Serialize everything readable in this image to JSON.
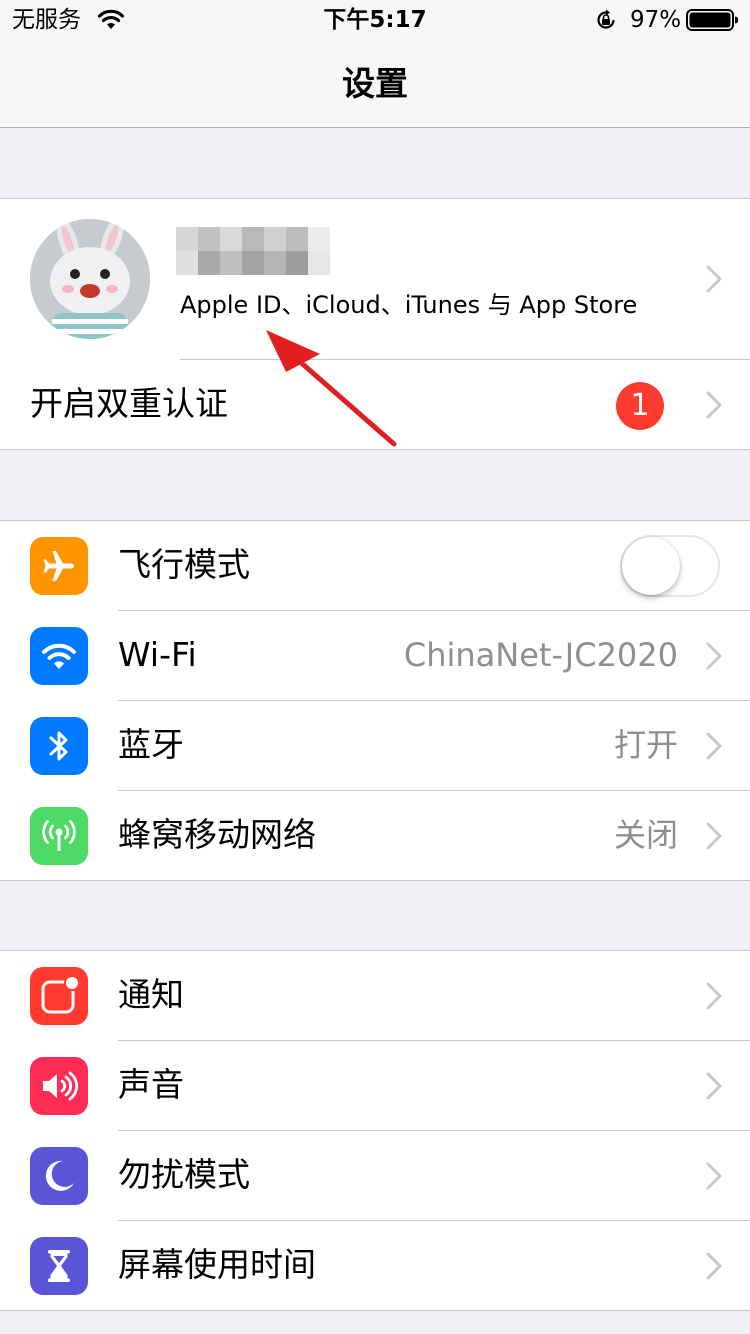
{
  "status_bar": {
    "carrier": "无服务",
    "time": "下午5:17",
    "battery_percent": "97%",
    "icons": [
      "wifi-icon",
      "orientation-lock-icon",
      "battery-icon"
    ]
  },
  "nav": {
    "title": "设置"
  },
  "apple_id": {
    "subtitle": "Apple ID、iCloud、iTunes 与 App Store",
    "name_blurred": true
  },
  "two_factor": {
    "label": "开启双重认证",
    "badge": "1"
  },
  "connectivity": [
    {
      "label": "飞行模式",
      "icon": "airplane-icon",
      "icon_color": "#ff9500",
      "control": "toggle",
      "toggle_on": false
    },
    {
      "label": "Wi-Fi",
      "value": "ChinaNet-JC2020",
      "icon": "wifi-icon",
      "icon_color": "#007aff"
    },
    {
      "label": "蓝牙",
      "value": "打开",
      "icon": "bluetooth-icon",
      "icon_color": "#007aff"
    },
    {
      "label": "蜂窝移动网络",
      "value": "关闭",
      "icon": "cellular-icon",
      "icon_color": "#4cd964"
    }
  ],
  "notifications": [
    {
      "label": "通知",
      "icon": "notifications-icon",
      "icon_color": "#ff3b30"
    },
    {
      "label": "声音",
      "icon": "sound-icon",
      "icon_color": "#ff2d55"
    },
    {
      "label": "勿扰模式",
      "icon": "moon-icon",
      "icon_color": "#5856d6"
    },
    {
      "label": "屏幕使用时间",
      "icon": "hourglass-icon",
      "icon_color": "#5856d6"
    }
  ],
  "colors": {
    "background": "#efeff4",
    "separator": "#c8c7cc",
    "badge": "#ff3b30",
    "annotation_arrow": "#e02020"
  }
}
